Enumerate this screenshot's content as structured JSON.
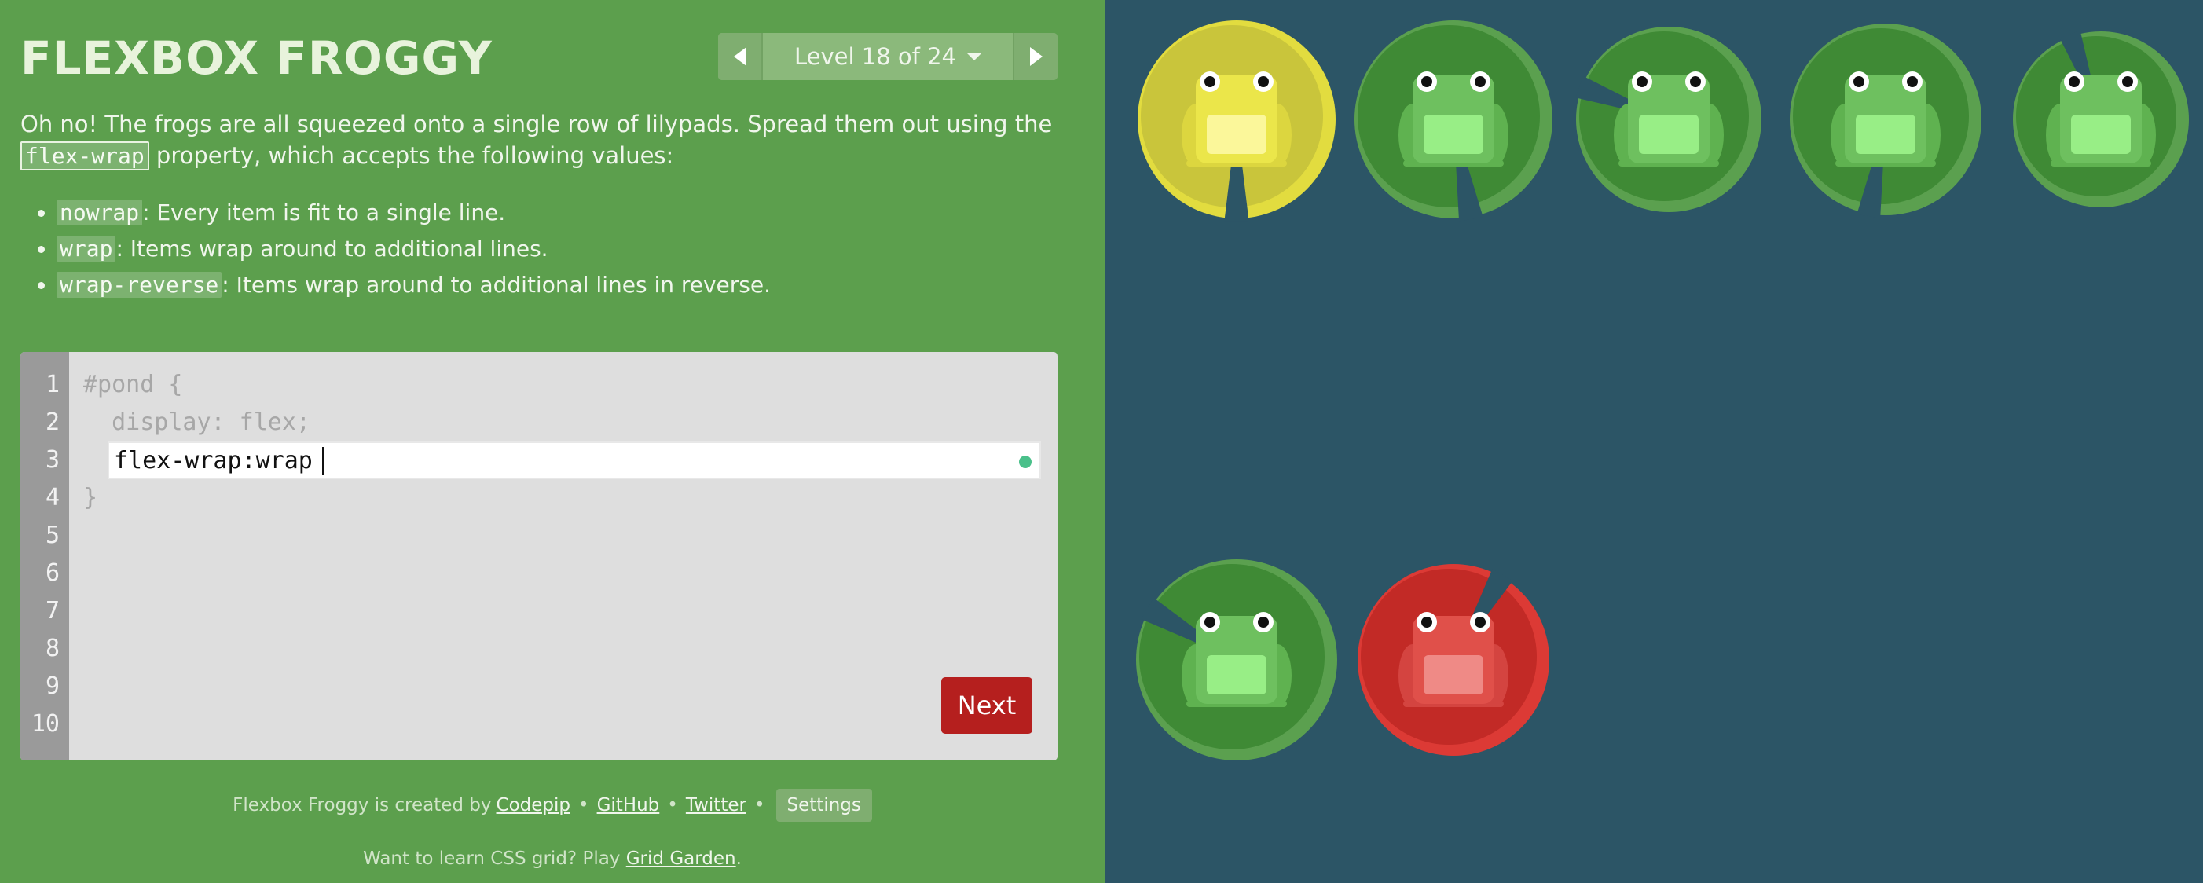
{
  "app": {
    "title": "FLEXBOX FROGGY"
  },
  "level_nav": {
    "prev_icon": "triangle-left-icon",
    "label": "Level 18 of 24",
    "dropdown_icon": "caret-down-icon",
    "next_icon": "triangle-right-icon"
  },
  "instructions": {
    "text_before": "Oh no! The frogs are all squeezed onto a single row of lilypads. Spread them out using the",
    "property": "flex-wrap",
    "text_after": " property, which accepts the following values:",
    "values": [
      {
        "name": "nowrap",
        "desc": ": Every item is fit to a single line."
      },
      {
        "name": "wrap",
        "desc": ": Items wrap around to additional lines."
      },
      {
        "name": "wrap-reverse",
        "desc": ": Items wrap around to additional lines in reverse."
      }
    ]
  },
  "editor": {
    "line_numbers": [
      "1",
      "2",
      "3",
      "4",
      "5",
      "6",
      "7",
      "8",
      "9",
      "10"
    ],
    "line1": "#pond {",
    "line2": "  display: flex;",
    "input_value": "flex-wrap:wrap",
    "line4": "}",
    "next_label": "Next",
    "status_color": "#4ac08a"
  },
  "footer": {
    "credits_prefix": "Flexbox Froggy is created by",
    "codepip": "Codepip",
    "github": "GitHub",
    "twitter": "Twitter",
    "separator": "•",
    "settings_label": "Settings",
    "promo_prefix": "Want to learn CSS grid? Play",
    "grid_garden": "Grid Garden",
    "promo_suffix": "."
  },
  "pond": {
    "background": "#2c5566",
    "lilypads": [
      {
        "color": "yellow",
        "frog": "yellow"
      },
      {
        "color": "green",
        "frog": "green"
      },
      {
        "color": "green",
        "frog": "green"
      },
      {
        "color": "green",
        "frog": "green"
      },
      {
        "color": "green",
        "frog": "green"
      },
      {
        "color": "green",
        "frog": "green"
      },
      {
        "color": "red",
        "frog": "red"
      }
    ]
  },
  "colors": {
    "sidebar": "#5c9f4d",
    "next_button": "#b51f1e",
    "pad_green": "#3f8a35",
    "pad_green_light": "#5ba04f",
    "pad_yellow": "#c9c53b",
    "pad_red": "#c22a26"
  }
}
